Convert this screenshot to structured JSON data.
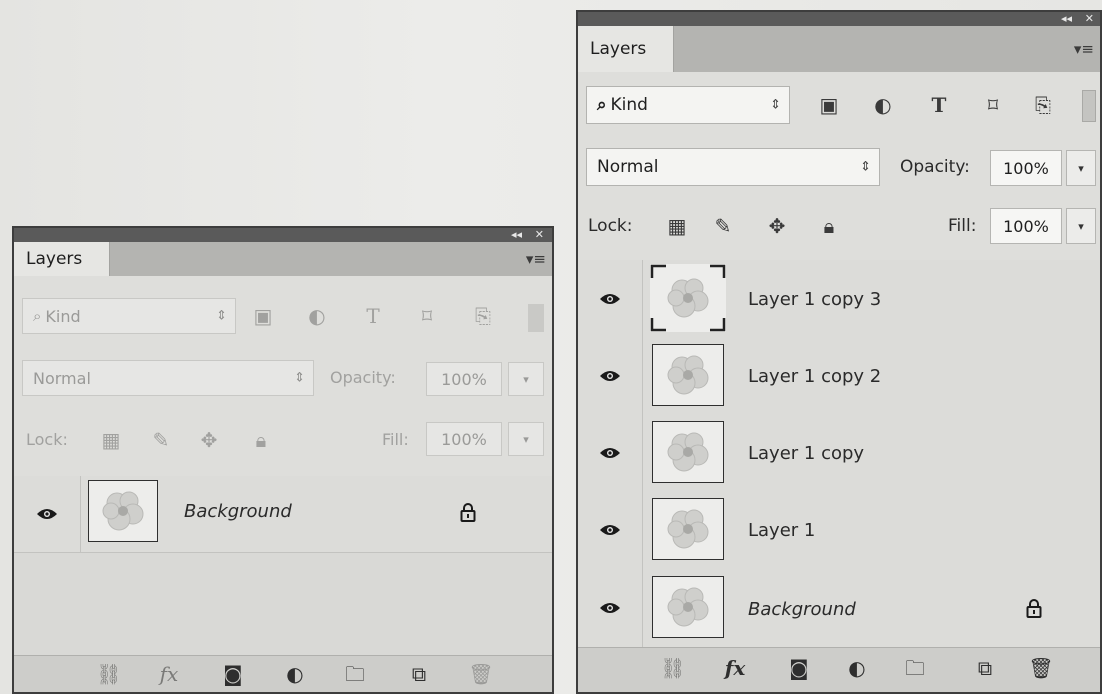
{
  "window_controls": {
    "collapse": "◂◂",
    "close": "✕"
  },
  "left_panel": {
    "tab_title": "Layers",
    "filter": {
      "value": "Kind"
    },
    "blend_mode": {
      "value": "Normal"
    },
    "opacity": {
      "label": "Opacity:",
      "value": "100%"
    },
    "lock_label": "Lock:",
    "fill": {
      "label": "Fill:",
      "value": "100%"
    },
    "layers": [
      {
        "name": "Background",
        "italic": true,
        "visible": true,
        "locked": true
      }
    ]
  },
  "right_panel": {
    "tab_title": "Layers",
    "filter": {
      "value": "Kind"
    },
    "blend_mode": {
      "value": "Normal"
    },
    "opacity": {
      "label": "Opacity:",
      "value": "100%"
    },
    "lock_label": "Lock:",
    "fill": {
      "label": "Fill:",
      "value": "100%"
    },
    "layers": [
      {
        "name": "Layer 1 copy 3",
        "italic": false,
        "visible": true,
        "locked": false,
        "selected_thumb": true
      },
      {
        "name": "Layer 1 copy 2",
        "italic": false,
        "visible": true,
        "locked": false
      },
      {
        "name": "Layer 1 copy",
        "italic": false,
        "visible": true,
        "locked": false
      },
      {
        "name": "Layer 1",
        "italic": false,
        "visible": true,
        "locked": false
      },
      {
        "name": "Background",
        "italic": true,
        "visible": true,
        "locked": true
      }
    ]
  },
  "icons": [
    "search-icon",
    "spinner-arrows-icon",
    "pixel-filter-icon",
    "adjustment-filter-icon",
    "type-filter-icon",
    "shape-filter-icon",
    "smart-object-filter-icon",
    "lock-transparent-icon",
    "lock-paint-brush-icon",
    "lock-position-icon",
    "lock-all-icon",
    "eye-icon",
    "padlock-icon",
    "link-layers-icon",
    "fx-icon",
    "mask-icon",
    "adjustment-layer-icon",
    "group-folder-icon",
    "new-layer-icon",
    "trash-icon",
    "panel-menu-icon"
  ],
  "colors": {
    "panel_bg": "#dededb",
    "titlebar": "#5a5a5a",
    "tab_strip": "#b4b4b1"
  }
}
